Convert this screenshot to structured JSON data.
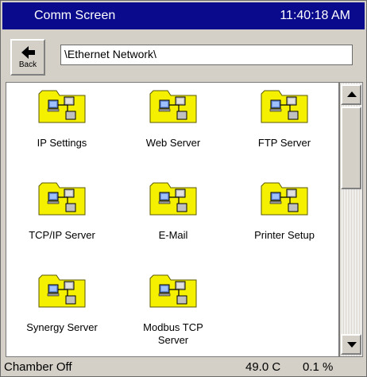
{
  "window": {
    "title": "Comm Screen",
    "time": "11:40:18 AM"
  },
  "toolbar": {
    "back_label": "Back",
    "path": "\\Ethernet Network\\"
  },
  "items": [
    {
      "label": "IP Settings"
    },
    {
      "label": "Web Server"
    },
    {
      "label": "FTP Server"
    },
    {
      "label": "TCP/IP Server"
    },
    {
      "label": "E-Mail"
    },
    {
      "label": "Printer Setup"
    },
    {
      "label": "Synergy Server"
    },
    {
      "label": "Modbus TCP\nServer"
    }
  ],
  "status": {
    "chamber": "Chamber Off",
    "temperature": "49.0 C",
    "percent": "0.1 %"
  },
  "colors": {
    "title_bar": "#0a0a8c",
    "folder": "#f5f000",
    "panel": "#d4d0c8"
  }
}
